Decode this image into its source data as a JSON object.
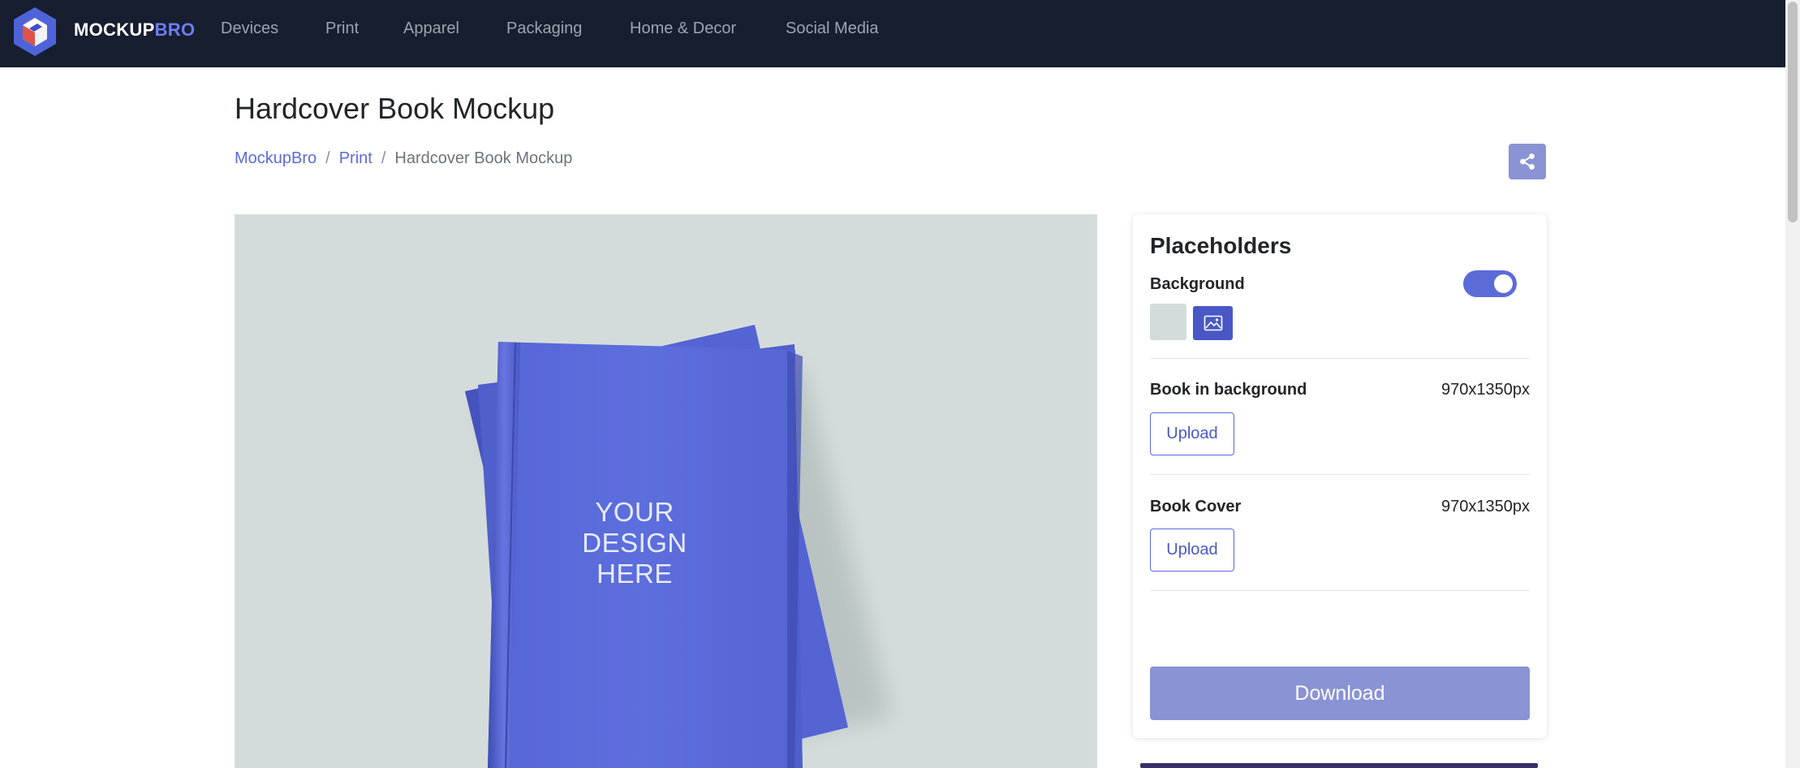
{
  "brand": {
    "name_main": "MOCKUP",
    "name_accent": "BRO",
    "colors": {
      "nav_bg": "#171e30",
      "accent": "#5b6bd8",
      "logo_outer": "#4f63d8",
      "logo_inner": "#e0524c"
    }
  },
  "nav": {
    "items": [
      "Devices",
      "Print",
      "Apparel",
      "Packaging",
      "Home & Decor",
      "Social Media"
    ]
  },
  "page": {
    "title": "Hardcover Book Mockup",
    "breadcrumb": [
      "MockupBro",
      "Print",
      "Hardcover Book Mockup"
    ],
    "share_icon": "share-icon"
  },
  "preview": {
    "design_text": [
      "YOUR",
      "DESIGN",
      "HERE"
    ],
    "colors": {
      "background": "#d4dcdb",
      "book": "#5b6bd8"
    }
  },
  "panel": {
    "title": "Placeholders",
    "background": {
      "label": "Background",
      "enabled": true,
      "swatch_color": "#d4dcdb",
      "image_icon": "image-icon"
    },
    "placeholders": [
      {
        "label": "Book in background",
        "dimensions": "970x1350px",
        "button": "Upload"
      },
      {
        "label": "Book Cover",
        "dimensions": "970x1350px",
        "button": "Upload"
      }
    ],
    "download_label": "Download"
  }
}
